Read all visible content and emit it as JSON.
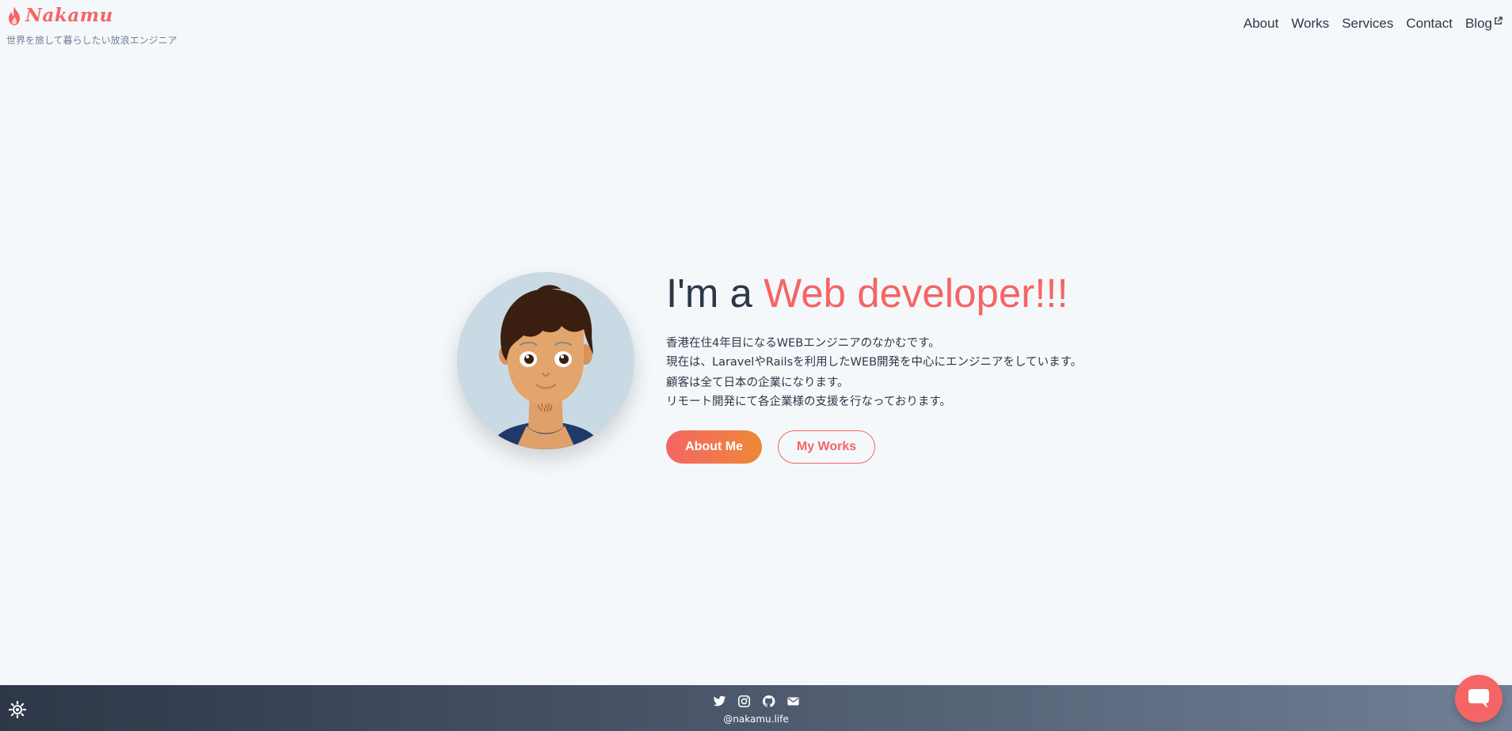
{
  "brand": {
    "logo_text": "Nakamu",
    "tagline": "世界を旅して暮らしたい放浪エンジニア"
  },
  "nav": {
    "items": [
      {
        "label": "About"
      },
      {
        "label": "Works"
      },
      {
        "label": "Services"
      },
      {
        "label": "Contact"
      },
      {
        "label": "Blog",
        "icon": "external-link-icon"
      }
    ]
  },
  "hero": {
    "headline_prefix": "I'm a ",
    "headline_accent": "Web developer!!!",
    "intro_lines": [
      "香港在住4年目になるWEBエンジニアのなかむです。",
      "現在は、LaravelやRailsを利用したWEB開発を中心にエンジニアをしています。",
      "顧客は全て日本の企業になります。",
      "リモート開発にて各企業様の支援を行なっております。"
    ],
    "primary_button": "About Me",
    "secondary_button": "My Works"
  },
  "footer": {
    "social": [
      "twitter-icon",
      "instagram-icon",
      "github-icon",
      "email-icon"
    ],
    "handle": "@nakamu.life",
    "theme_toggle_icon": "sun-icon"
  },
  "chat": {
    "icon": "chat-bubble-icon"
  },
  "colors": {
    "accent": "#f56565",
    "accent_gradient_end": "#ed8936",
    "background": "#f5f8fb",
    "text": "#2d3748",
    "footer_start": "#2d3748",
    "footer_end": "#718096"
  }
}
